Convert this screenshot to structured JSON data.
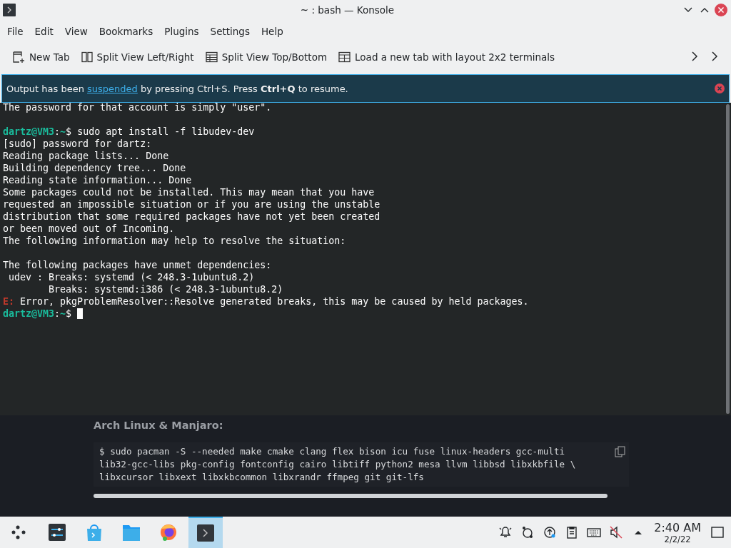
{
  "window": {
    "title": "~ : bash — Konsole"
  },
  "menu": [
    "File",
    "Edit",
    "View",
    "Bookmarks",
    "Plugins",
    "Settings",
    "Help"
  ],
  "toolbar": [
    {
      "kind": "newtab",
      "label": "New Tab"
    },
    {
      "kind": "splitlr",
      "label": "Split View Left/Right"
    },
    {
      "kind": "splittb",
      "label": "Split View Top/Bottom"
    },
    {
      "kind": "grid",
      "label": "Load a new tab with layout 2x2 terminals"
    }
  ],
  "banner": {
    "before": "Output has been ",
    "link": "suspended",
    "after": " by pressing Ctrl+S. Press **Ctrl+Q** to resume."
  },
  "terminal": [
    {
      "kind": "output",
      "text": "The password for that account is simply \"user\"."
    },
    {
      "kind": "blank"
    },
    {
      "kind": "prompt",
      "user": "dartz@VM3",
      "sep": ":",
      "path": "~",
      "sign": "$",
      "command": "sudo apt install -f libudev-dev"
    },
    {
      "kind": "output",
      "text": "[sudo] password for dartz:"
    },
    {
      "kind": "output",
      "text": "Reading package lists... Done"
    },
    {
      "kind": "output",
      "text": "Building dependency tree... Done"
    },
    {
      "kind": "output",
      "text": "Reading state information... Done"
    },
    {
      "kind": "output",
      "text": "Some packages could not be installed. This may mean that you have"
    },
    {
      "kind": "output",
      "text": "requested an impossible situation or if you are using the unstable"
    },
    {
      "kind": "output",
      "text": "distribution that some required packages have not yet been created"
    },
    {
      "kind": "output",
      "text": "or been moved out of Incoming."
    },
    {
      "kind": "output",
      "text": "The following information may help to resolve the situation:"
    },
    {
      "kind": "blank"
    },
    {
      "kind": "output",
      "text": "The following packages have unmet dependencies:"
    },
    {
      "kind": "output",
      "text": " udev : Breaks: systemd (< 248.3-1ubuntu8.2)"
    },
    {
      "kind": "output",
      "text": "        Breaks: systemd:i386 (< 248.3-1ubuntu8.2)"
    },
    {
      "kind": "error",
      "tag": "E:",
      "text": " Error, pkgProblemResolver::Resolve generated breaks, this may be caused by held packages."
    },
    {
      "kind": "prompt",
      "user": "dartz@VM3",
      "sep": ":",
      "path": "~",
      "sign": "$",
      "cursor": true
    }
  ],
  "webpage": {
    "heading": "Arch Linux & Manjaro:",
    "code": [
      "$ sudo pacman -S --needed make cmake clang flex bison icu fuse linux-headers gcc-multi",
      "lib32-gcc-libs pkg-config fontconfig cairo libtiff python2 mesa llvm libbsd libxkbfile \\",
      "libxcursor libxext libxkbcommon libxrandr ffmpeg git git-lfs"
    ]
  },
  "taskbar": {
    "apps": [
      {
        "kind": "launcher",
        "selected": false
      },
      {
        "kind": "settings",
        "selected": false
      },
      {
        "kind": "store",
        "selected": false
      },
      {
        "kind": "files",
        "selected": false
      },
      {
        "kind": "browser",
        "selected": false
      },
      {
        "kind": "terminal",
        "selected": true
      }
    ],
    "tray": [
      {
        "kind": "bell"
      },
      {
        "kind": "network"
      },
      {
        "kind": "update"
      },
      {
        "kind": "clipboard"
      },
      {
        "kind": "keyboard"
      },
      {
        "kind": "muted"
      },
      {
        "kind": "expand"
      }
    ],
    "time": "2:40 AM",
    "date": "2/2/22"
  }
}
